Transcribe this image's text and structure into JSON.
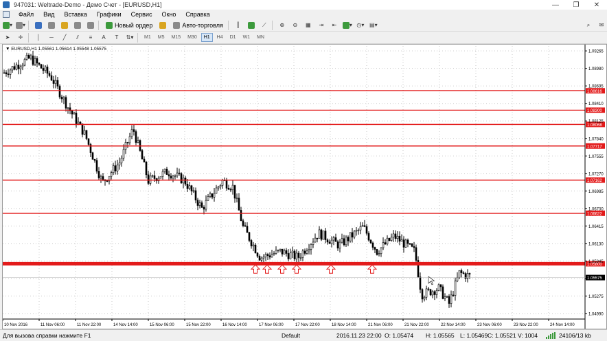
{
  "window": {
    "title": "947031: Weltrade-Demo - Демо Счет - [EURUSD,H1]"
  },
  "menu": [
    "Файл",
    "Вид",
    "Вставка",
    "Графики",
    "Сервис",
    "Окно",
    "Справка"
  ],
  "toolbar": {
    "new_order": "Новый ордер",
    "auto_trading": "Авто-торговля"
  },
  "timeframes": [
    "M1",
    "M5",
    "M15",
    "M30",
    "H1",
    "H4",
    "D1",
    "W1",
    "MN"
  ],
  "active_timeframe": "H1",
  "chart": {
    "caption": "EURUSD,H1  1.05561 1.05614 1.05548 1.05575",
    "price_labels": [
      "1.09265",
      "1.08980",
      "1.08695",
      "1.08410",
      "1.08125",
      "1.07840",
      "1.07555",
      "1.07270",
      "1.06985",
      "1.06700",
      "1.06415",
      "1.06130",
      "1.05845",
      "1.05560",
      "1.05275",
      "1.04990"
    ],
    "time_labels": [
      "10 Nov 2016",
      "11 Nov 06:00",
      "11 Nov 22:00",
      "14 Nov 14:00",
      "15 Nov 06:00",
      "15 Nov 22:00",
      "16 Nov 14:00",
      "17 Nov 06:00",
      "17 Nov 22:00",
      "18 Nov 14:00",
      "21 Nov 06:00",
      "21 Nov 22:00",
      "22 Nov 14:00",
      "23 Nov 06:00",
      "23 Nov 22:00",
      "24 Nov 14:00"
    ],
    "levels": [
      1.08616,
      1.083,
      1.08068,
      1.07717,
      1.07162,
      1.06622,
      1.058
    ],
    "current_price": "1.05575",
    "colors": {
      "level": "#e31b1b",
      "candle": "#000000",
      "grid": "#c8c8c8",
      "arrow": "#e31b1b",
      "bid_tag": "#000000"
    }
  },
  "status": {
    "help": "Для вызова справки нажмите F1",
    "profile": "Default",
    "time": "2016.11.23 22:00",
    "open": "O: 1.05474",
    "high": "H: 1.05565",
    "low": "L: 1.05469",
    "close": "C: 1.05521",
    "volume": "V: 1004",
    "traffic": "24106/13 kb"
  }
}
